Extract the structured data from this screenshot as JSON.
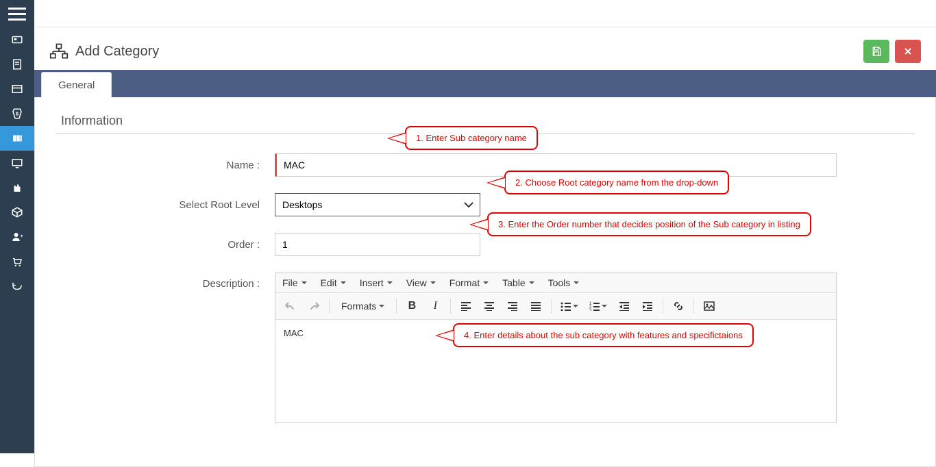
{
  "page": {
    "title": "Add Category"
  },
  "tabs": {
    "general": "General"
  },
  "section": {
    "information": "Information"
  },
  "form": {
    "name_label": "Name :",
    "name_value": "MAC",
    "root_label": "Select Root Level",
    "root_value": "Desktops",
    "order_label": "Order :",
    "order_value": "1",
    "description_label": "Description :"
  },
  "editor": {
    "menus": {
      "file": "File",
      "edit": "Edit",
      "insert": "Insert",
      "view": "View",
      "format": "Format",
      "table": "Table",
      "tools": "Tools"
    },
    "formats": "Formats",
    "body": "MAC"
  },
  "callouts": {
    "c1": "1. Enter Sub category name",
    "c2": "2.  Choose Root category name from the drop-down",
    "c3": "3. Enter the Order number that decides position of the Sub category in listing",
    "c4": "4. Enter details about the sub category with features and specifictaions"
  },
  "colors": {
    "sidebar": "#2c3e50",
    "active": "#3498db",
    "tabbar": "#4c5e84",
    "success": "#5cb85c",
    "danger": "#d9534f",
    "callout": "#e30000"
  }
}
